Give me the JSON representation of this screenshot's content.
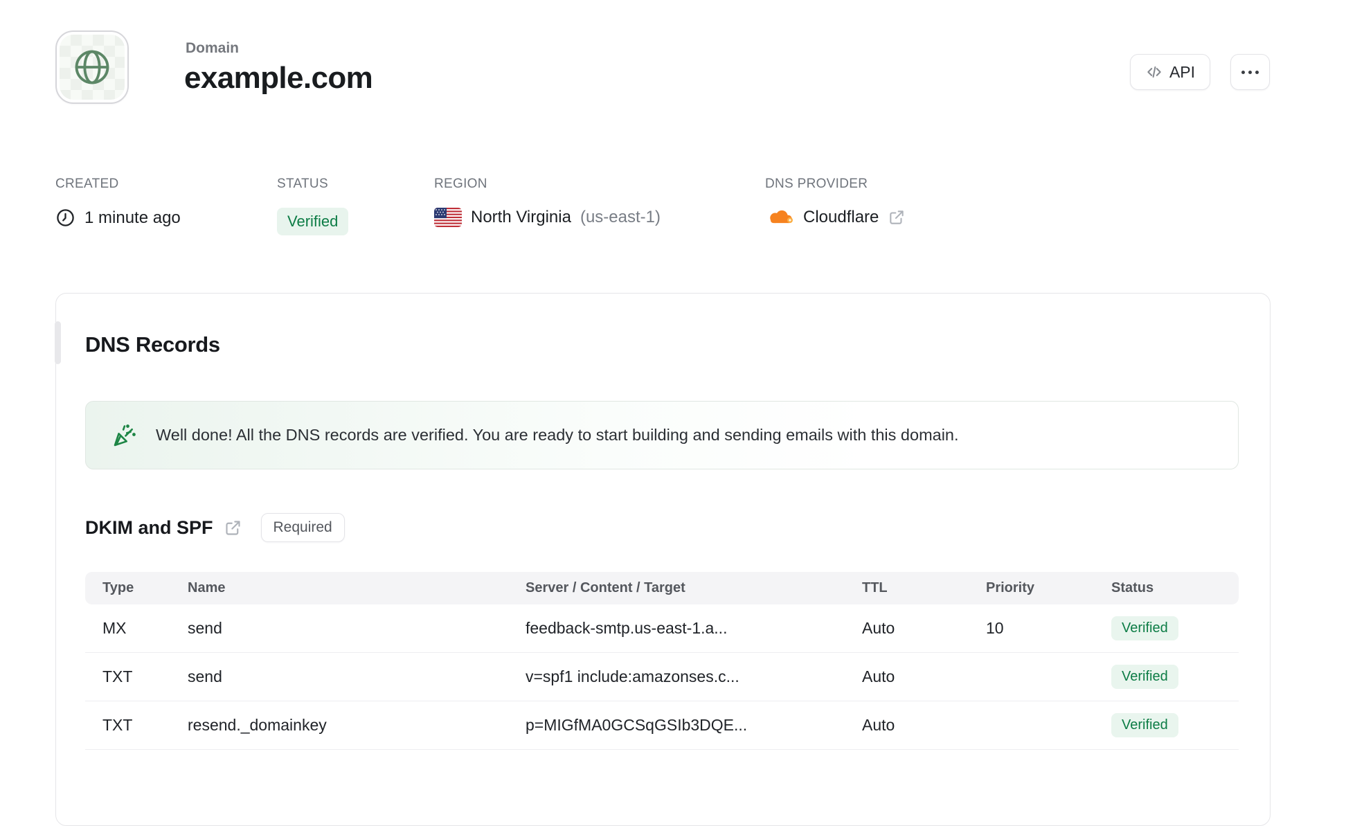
{
  "header": {
    "icon": "globe-icon",
    "label": "Domain",
    "title": "example.com",
    "actions": {
      "api_label": "API",
      "api_icon": "code-icon",
      "more_icon": "ellipsis-icon"
    }
  },
  "meta": {
    "created": {
      "label": "CREATED",
      "icon": "clock-icon",
      "value": "1 minute ago"
    },
    "status": {
      "label": "STATUS",
      "value": "Verified"
    },
    "region": {
      "label": "REGION",
      "icon": "us-flag-icon",
      "value": "North Virginia",
      "code": "(us-east-1)"
    },
    "dns_provider": {
      "label": "DNS PROVIDER",
      "icon": "cloudflare-icon",
      "value": "Cloudflare",
      "link_icon": "external-link-icon"
    }
  },
  "dns_card": {
    "title": "DNS Records",
    "banner": {
      "icon": "party-popper-icon",
      "text": "Well done! All the DNS records are verified. You are ready to start building and sending emails with this domain."
    },
    "section": {
      "title": "DKIM and SPF",
      "link_icon": "external-link-icon",
      "badge": "Required"
    },
    "table": {
      "headers": [
        "Type",
        "Name",
        "Server / Content / Target",
        "TTL",
        "Priority",
        "Status"
      ],
      "rows": [
        {
          "type": "MX",
          "name": "send",
          "content": "feedback-smtp.us-east-1.a...",
          "ttl": "Auto",
          "priority": "10",
          "status": "Verified"
        },
        {
          "type": "TXT",
          "name": "send",
          "content": "v=spf1 include:amazonses.c...",
          "ttl": "Auto",
          "priority": "",
          "status": "Verified"
        },
        {
          "type": "TXT",
          "name": "resend._domainkey",
          "content": "p=MIGfMA0GCSqGSIb3DQE...",
          "ttl": "Auto",
          "priority": "",
          "status": "Verified"
        }
      ]
    }
  },
  "colors": {
    "verified_text": "#0c7c45",
    "verified_bg": "#e9f5ee",
    "cloudflare_orange": "#f6821f",
    "globe_green": "#5c8766",
    "banner_green_bg": "#ebf4ee",
    "border_gray": "#e5e5e8",
    "table_header_bg": "#f4f4f6"
  }
}
